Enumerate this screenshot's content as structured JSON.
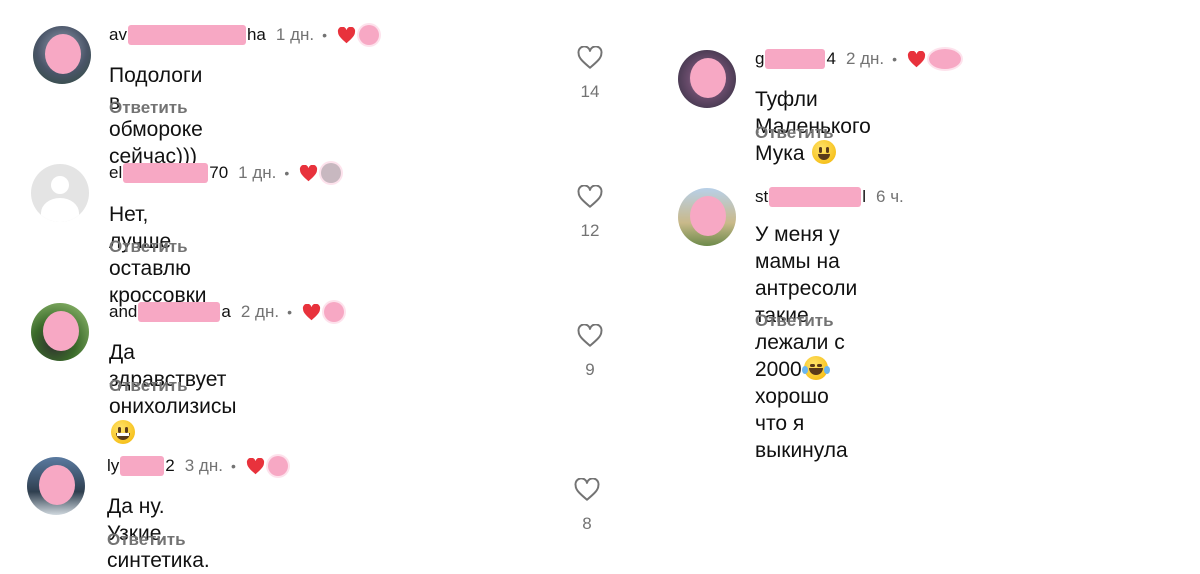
{
  "comments": [
    {
      "username_start": "av",
      "username_end": "ha",
      "time": "1 дн.",
      "text": "Подологи в обмороке сейчас)))",
      "reply": "Ответить",
      "likes": "14"
    },
    {
      "username_start": "el",
      "username_end": "70",
      "time": "1 дн.",
      "text": "Нет, лучше оставлю кроссовки",
      "reply": "Ответить",
      "likes": "12"
    },
    {
      "username_start": "and",
      "username_end": "a",
      "time": "2 дн.",
      "text": "Да здравствует онихолизисы",
      "reply": "Ответить",
      "likes": "9"
    },
    {
      "username_start": "ly",
      "username_end": "2",
      "time": "3 дн.",
      "text": "Да ну. Узкие, синтетика.",
      "reply": "Ответить",
      "likes": "8"
    },
    {
      "username_start": "g",
      "username_end": "4",
      "time": "2 дн.",
      "text": "Туфли Маленького Мука",
      "reply": "Ответить"
    },
    {
      "username_start": "st",
      "username_end": "l",
      "time": "6 ч.",
      "text_line1": "У меня у мамы на антресоли такие",
      "text_line2": "лежали с 2000",
      "text_line2_after": "хорошо что я",
      "text_line3": "выкинула",
      "reply": "Ответить"
    }
  ],
  "meta_separator": "•",
  "colors": {
    "heart_red": "#e8323c",
    "redaction_pink": "#f7a8c4",
    "secondary_text": "#737373"
  },
  "icons": {
    "like": "heart-outline-icon",
    "author_liked": "heart-filled-icon",
    "grin": "grinning-emoji",
    "smile": "smiley-emoji",
    "joy": "tears-of-joy-emoji"
  }
}
